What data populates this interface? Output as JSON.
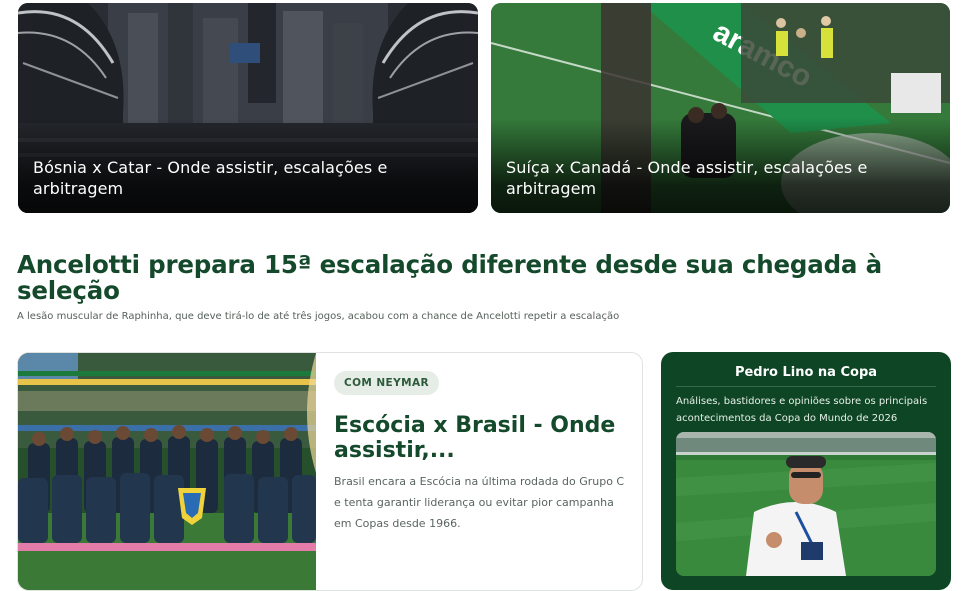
{
  "cards": [
    {
      "title": "Bósnia x Catar - Onde assistir, escalações e arbitragem",
      "image_subject": "stadium"
    },
    {
      "title": "Suíça x Canadá - Onde assistir, escalações e arbitragem",
      "image_subject": "players-celebrating",
      "board_text": "aramco"
    }
  ],
  "headline": {
    "title": "Ancelotti prepara 15ª escalação diferente desde sua chegada à seleção",
    "subtitle": "A lesão muscular de Raphinha, que deve tirá-lo de até três jogos, acabou com a chance de Ancelotti repetir a escalação"
  },
  "article": {
    "tag": "COM NEYMAR",
    "title": "Escócia x Brasil - Onde assistir,...",
    "description": "Brasil encara a Escócia na última rodada do Grupo C e tenta garantir liderança ou evitar pior campanha em Copas desde 1966.",
    "image_subject": "team-photo"
  },
  "promo": {
    "title": "Pedro Lino na Copa",
    "description": "Análises, bastidores e opiniões sobre os principais acontecimentos da Copa do Mundo de 2026",
    "image_subject": "reporter-at-stadium"
  },
  "colors": {
    "brand_green": "#144a2b",
    "promo_bg": "#0e4625",
    "tag_bg": "#e6ede7"
  }
}
